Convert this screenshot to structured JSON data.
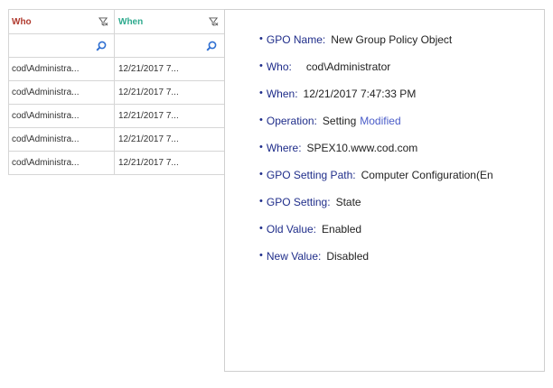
{
  "grid": {
    "headers": {
      "who": "Who",
      "when": "When"
    },
    "rows": [
      {
        "who": "cod\\Administra...",
        "when": "12/21/2017 7..."
      },
      {
        "who": "cod\\Administra...",
        "when": "12/21/2017 7..."
      },
      {
        "who": "cod\\Administra...",
        "when": "12/21/2017 7..."
      },
      {
        "who": "cod\\Administra...",
        "when": "12/21/2017 7..."
      },
      {
        "who": "cod\\Administra...",
        "when": "12/21/2017 7..."
      }
    ]
  },
  "details": {
    "gpo_name": {
      "label": "GPO Name:",
      "value": "New Group Policy Object"
    },
    "who": {
      "label": "Who:",
      "value": "cod\\Administrator"
    },
    "when": {
      "label": "When:",
      "value": "12/21/2017 7:47:33 PM"
    },
    "operation": {
      "label": "Operation:",
      "value": "Setting",
      "accent": "Modified"
    },
    "where": {
      "label": "Where:",
      "value": "SPEX10.www.cod.com"
    },
    "gpo_setting_path": {
      "label": "GPO Setting Path:",
      "value": "Computer Configuration(En"
    },
    "gpo_setting": {
      "label": "GPO Setting:",
      "value": "State"
    },
    "old_value": {
      "label": "Old Value:",
      "value": "Enabled"
    },
    "new_value": {
      "label": "New Value:",
      "value": "Disabled"
    }
  },
  "colors": {
    "who_header": "#b03a2e",
    "when_header": "#2eaa8e",
    "label": "#1f2d8a",
    "accent": "#4a5cc8"
  },
  "icons": [
    "filter-icon",
    "search-icon"
  ]
}
